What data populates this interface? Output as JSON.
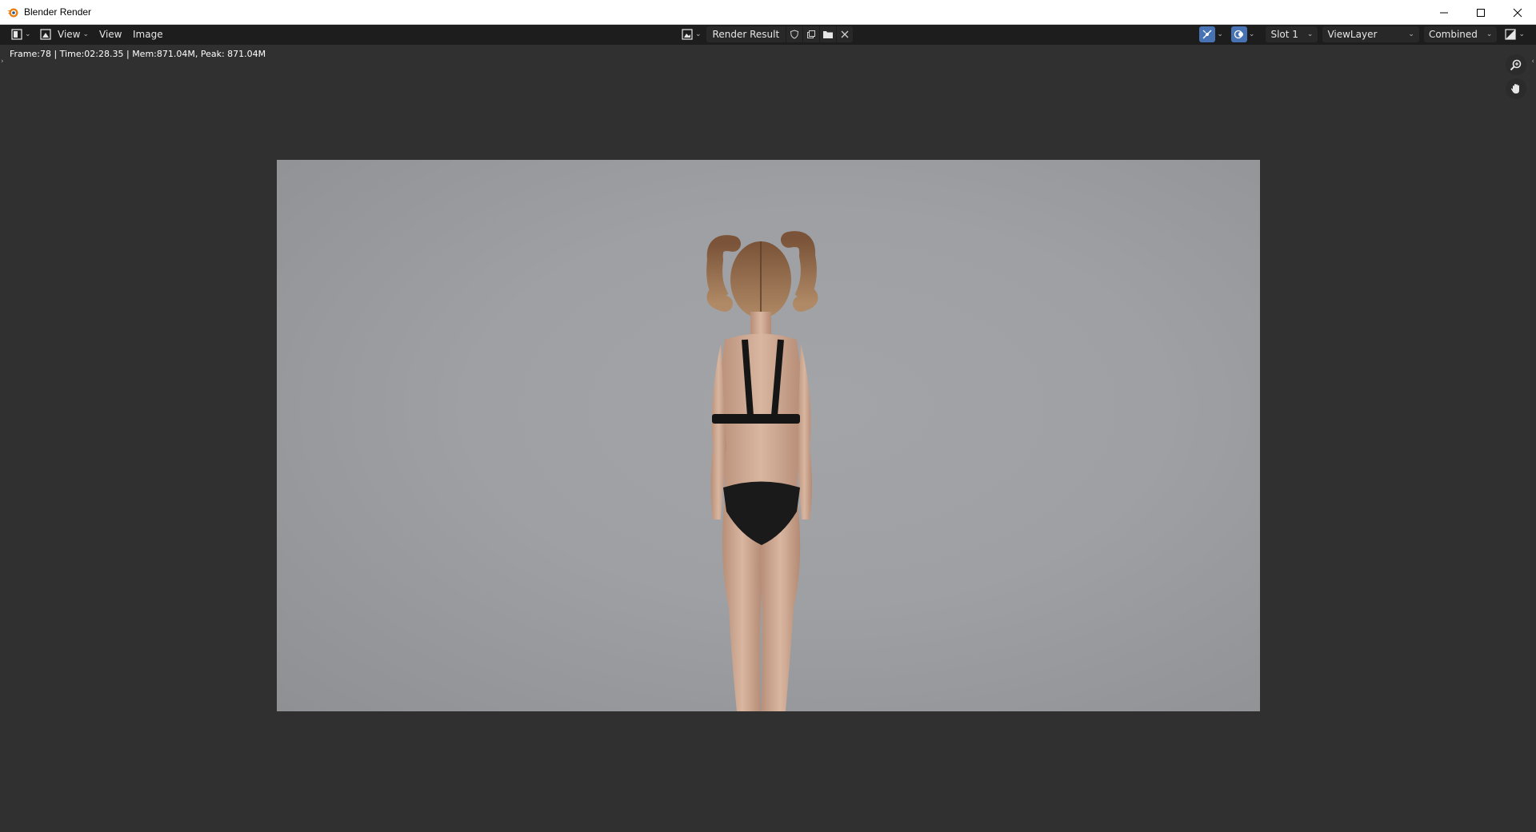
{
  "window": {
    "title": "Blender Render",
    "controls": [
      "minimize-icon",
      "maximize-icon",
      "close-icon"
    ]
  },
  "header": {
    "editor_type_icon": "image-editor-icon",
    "view_mode_label": "View",
    "menus": [
      "View",
      "Image"
    ],
    "image_name": "Render Result",
    "image_buttons": [
      "shield-icon",
      "duplicate-icon",
      "folder-icon",
      "x-icon"
    ],
    "slot": "Slot 1",
    "view_layer": "ViewLayer",
    "pass": "Combined"
  },
  "status": {
    "text": "Frame:78 | Time:02:28.35 | Mem:871.04M, Peak: 871.04M"
  },
  "viewer": {
    "image_description_icon": "render-result-image",
    "background_color": "#303030",
    "render_bg_color": "#9ea0a4"
  },
  "colors": {
    "accent": "#4772b3",
    "header_bg": "#1d1d1d"
  }
}
